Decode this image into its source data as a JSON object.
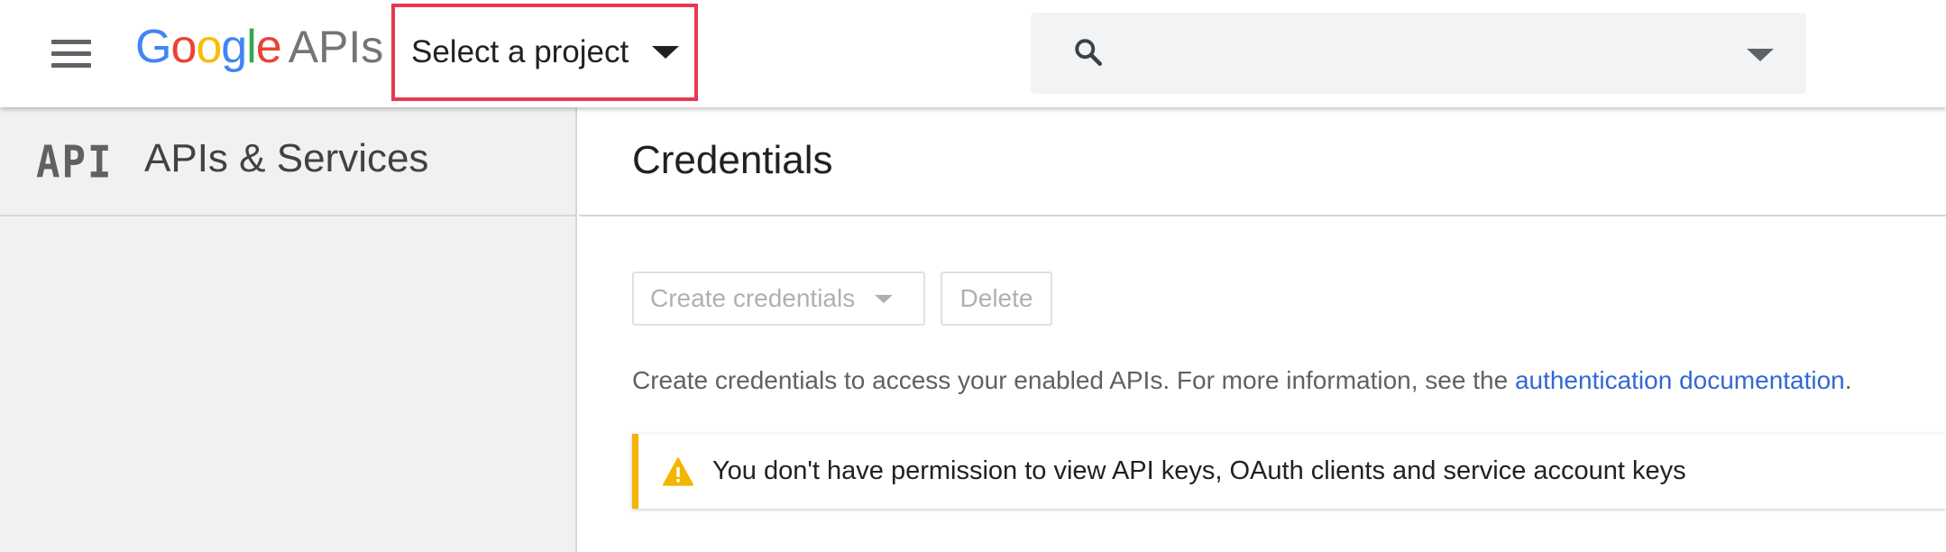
{
  "topbar": {
    "logo_google_letters": [
      "G",
      "o",
      "o",
      "g",
      "l",
      "e"
    ],
    "logo_apis": "APIs",
    "project_select_label": "Select a project",
    "search": {
      "placeholder": "",
      "value": ""
    },
    "icons": [
      "menu-icon",
      "search-icon",
      "chevron-down-icon"
    ]
  },
  "sidebar": {
    "icon_text": "API",
    "title": "APIs & Services"
  },
  "main": {
    "title": "Credentials",
    "buttons": {
      "create_credentials": "Create credentials",
      "delete": "Delete"
    },
    "info": {
      "text": "Create credentials to access your enabled APIs. For more information, see the ",
      "link": "authentication documentation",
      "suffix": "."
    },
    "alert": {
      "text": "You don't have permission to view API keys, OAuth clients and service account keys"
    }
  },
  "colors": {
    "highlight_border": "#e8384f",
    "link": "#3367d6",
    "warning": "#f4b400",
    "google_blue": "#4285f4",
    "google_red": "#ea4335",
    "google_yellow": "#fbbc05",
    "google_green": "#34a853"
  }
}
